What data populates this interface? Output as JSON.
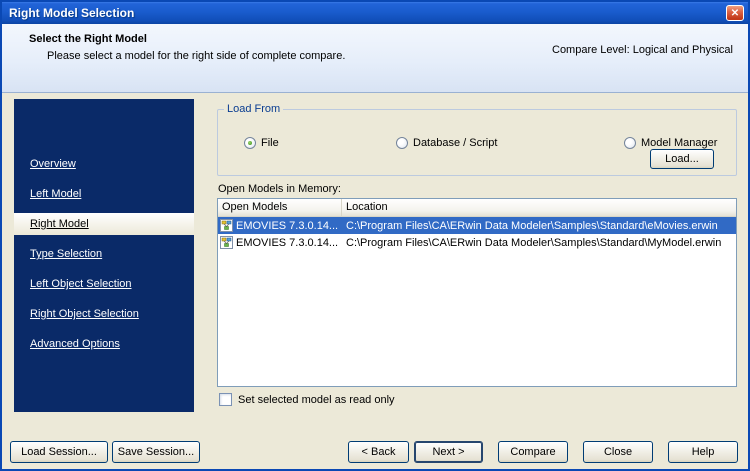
{
  "window": {
    "title": "Right Model Selection"
  },
  "icons": {
    "close": "✕"
  },
  "header": {
    "title": "Select the Right Model",
    "subtitle": "Please select a model for the right side of complete compare.",
    "compare_level": "Compare Level: Logical and Physical"
  },
  "sidebar": {
    "items": [
      {
        "label": "Overview",
        "active": false
      },
      {
        "label": "Left Model",
        "active": false
      },
      {
        "label": "Right Model",
        "active": true
      },
      {
        "label": "Type Selection",
        "active": false
      },
      {
        "label": "Left Object Selection",
        "active": false
      },
      {
        "label": "Right Object Selection",
        "active": false
      },
      {
        "label": "Advanced Options",
        "active": false
      }
    ]
  },
  "load_from": {
    "group_label": "Load From",
    "options": [
      {
        "label": "File",
        "selected": true
      },
      {
        "label": "Database / Script",
        "selected": false
      },
      {
        "label": "Model Manager",
        "selected": false
      }
    ],
    "load_button_label": "Load..."
  },
  "models": {
    "list_label": "Open Models in Memory:",
    "columns": {
      "name": "Open Models",
      "location": "Location"
    },
    "rows": [
      {
        "name": "EMOVIES 7.3.0.14...",
        "location": "C:\\Program Files\\CA\\ERwin Data Modeler\\Samples\\Standard\\eMovies.erwin",
        "selected": true
      },
      {
        "name": "EMOVIES 7.3.0.14...",
        "location": "C:\\Program Files\\CA\\ERwin Data Modeler\\Samples\\Standard\\MyModel.erwin",
        "selected": false
      }
    ]
  },
  "read_only": {
    "label": "Set selected model as read only",
    "checked": false
  },
  "footer": {
    "load_session": "Load Session...",
    "save_session": "Save Session...",
    "back": "< Back",
    "next": "Next >",
    "compare": "Compare",
    "close": "Close",
    "help": "Help"
  }
}
